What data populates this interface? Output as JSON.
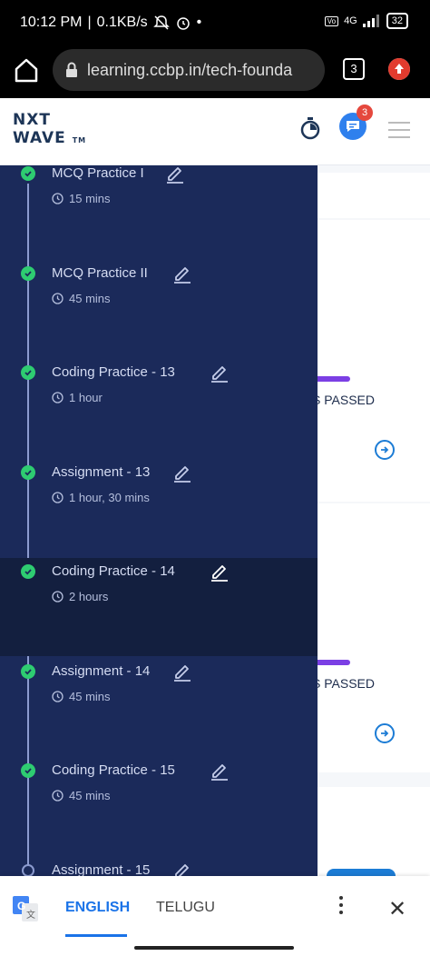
{
  "status_bar": {
    "time": "10:12 PM",
    "speed": "0.1KB/s",
    "dot": "•",
    "network": "4G",
    "battery": "32"
  },
  "browser": {
    "url": "learning.ccbp.in/tech-founda",
    "tab_count": "3"
  },
  "header": {
    "logo_line1": "NXT",
    "logo_line2": "WAVE",
    "logo_tm": "TM",
    "notification_count": "3"
  },
  "background_cards": [
    {
      "status": "S PASSED"
    },
    {
      "status": "S PASSED"
    }
  ],
  "drawer": {
    "items": [
      {
        "title": "MCQ Practice I",
        "duration": "15 mins",
        "completed": true,
        "active": false
      },
      {
        "title": "MCQ Practice II",
        "duration": "45 mins",
        "completed": true,
        "active": false
      },
      {
        "title": "Coding Practice - 13",
        "duration": "1 hour",
        "completed": true,
        "active": false
      },
      {
        "title": "Assignment - 13",
        "duration": "1 hour, 30 mins",
        "completed": true,
        "active": false
      },
      {
        "title": "Coding Practice - 14",
        "duration": "2 hours",
        "completed": true,
        "active": true
      },
      {
        "title": "Assignment - 14",
        "duration": "45 mins",
        "completed": true,
        "active": false
      },
      {
        "title": "Coding Practice - 15",
        "duration": "45 mins",
        "completed": true,
        "active": false
      },
      {
        "title": "Assignment - 15",
        "duration": "",
        "completed": false,
        "active": false
      }
    ]
  },
  "translate_bar": {
    "lang_selected": "ENGLISH",
    "lang_other": "TELUGU"
  },
  "colors": {
    "drawer_bg": "#1b2a5a",
    "active_bg": "#131f3f",
    "check_green": "#2ecc71",
    "accent_blue": "#1a73e8",
    "progress_purple": "#7b3fe4"
  }
}
